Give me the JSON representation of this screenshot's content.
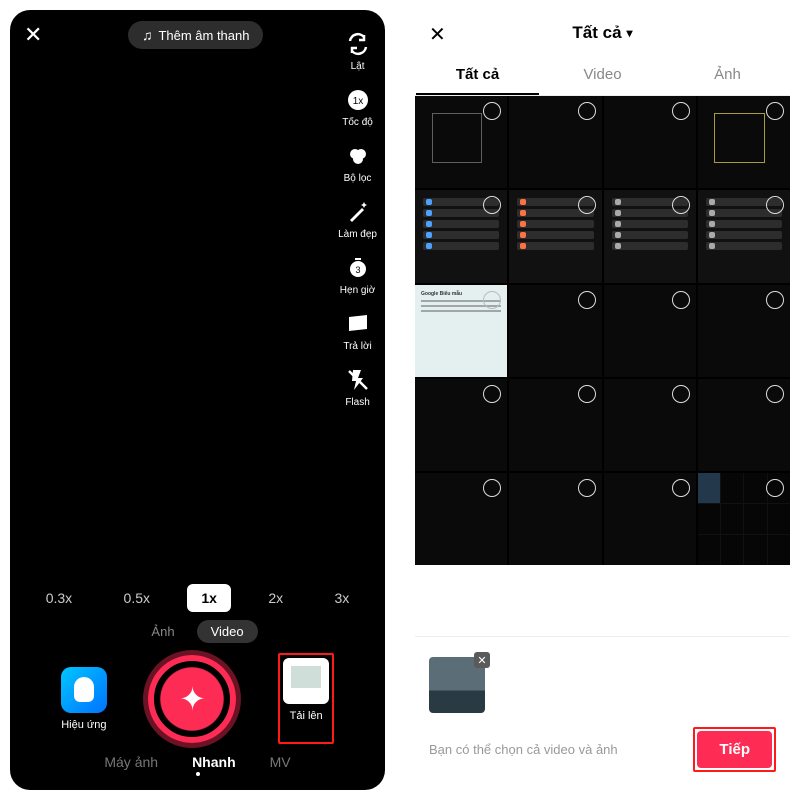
{
  "recorder": {
    "soundLabel": "Thêm âm thanh",
    "tools": {
      "flip": "Lật",
      "speed": "Tốc độ",
      "filter": "Bộ lọc",
      "beauty": "Làm đẹp",
      "timer": "Hẹn giờ",
      "reply": "Trả lời",
      "flash": "Flash"
    },
    "speeds": [
      "0.3x",
      "0.5x",
      "1x",
      "2x",
      "3x"
    ],
    "speedSelected": "1x",
    "mediaTabs": {
      "photo": "Ảnh",
      "video": "Video"
    },
    "effects": "Hiệu ứng",
    "upload": "Tải lên",
    "modes": {
      "camera": "Máy ảnh",
      "quick": "Nhanh",
      "mv": "MV"
    }
  },
  "picker": {
    "title": "Tất cả",
    "tabs": {
      "all": "Tất cả",
      "video": "Video",
      "photo": "Ảnh"
    },
    "formTitle": "Google Biểu mẫu",
    "hint": "Bạn có thể chọn cả video và ảnh",
    "next": "Tiếp"
  }
}
